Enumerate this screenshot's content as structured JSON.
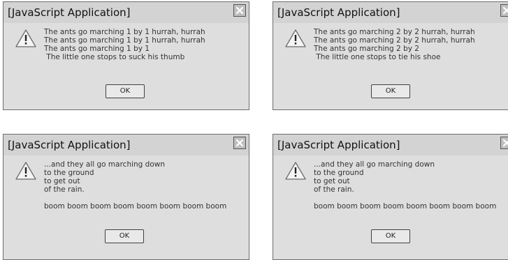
{
  "dialogs": [
    {
      "title": "[JavaScript Application]",
      "message": [
        "The ants go marching 1 by 1 hurrah, hurrah",
        "The ants go marching 1 by 1 hurrah, hurrah",
        "The ants go marching 1 by 1",
        " The little one stops to suck his thumb"
      ],
      "ok_label": "OK"
    },
    {
      "title": "[JavaScript Application]",
      "message": [
        "The ants go marching 2 by 2 hurrah, hurrah",
        "The ants go marching 2 by 2 hurrah, hurrah",
        "The ants go marching 2 by 2",
        " The little one stops to tie his shoe"
      ],
      "ok_label": "OK"
    },
    {
      "title": "[JavaScript Application]",
      "message": [
        "...and they all go marching down",
        "to the ground",
        "to get out",
        "of the rain.",
        "",
        "boom boom boom boom boom boom boom boom"
      ],
      "ok_label": "OK"
    },
    {
      "title": "[JavaScript Application]",
      "message": [
        "...and they all go marching down",
        "to the ground",
        "to get out",
        "of the rain.",
        "",
        "boom boom boom boom boom boom boom boom"
      ],
      "ok_label": "OK"
    }
  ],
  "icons": {
    "warning": "warning-icon",
    "close": "close-icon"
  },
  "colors": {
    "dialog_bg": "#dedede",
    "titlebar_bg": "#d3d3d3",
    "border": "#6d6d6d",
    "text": "#333333"
  }
}
